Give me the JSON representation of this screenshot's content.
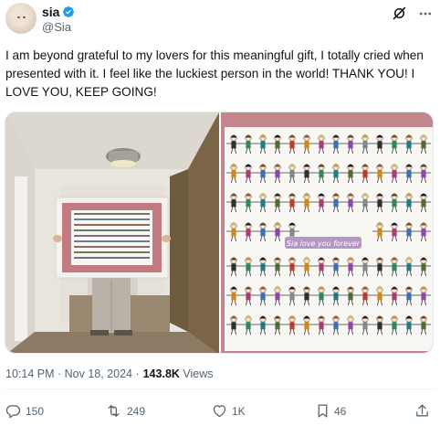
{
  "user": {
    "display_name": "sia",
    "handle": "@Sia",
    "verified": true
  },
  "tweet": {
    "text": "I am beyond grateful to my lovers for this meaningful gift, I totally cried when presented with it. I feel like the luckiest person in the world! THANK YOU! I LOVE YOU, KEEP GOING!",
    "timestamp": "10:14 PM · Nov 18, 2024 · ",
    "views_count": "143.8K",
    "views_label": " Views"
  },
  "media": {
    "image_1": "person-holding-framed-drawing-in-hallway",
    "image_2": "close-up-of-drawn-stick-figures-in-frame",
    "banner_text": "Sia love you forever"
  },
  "actions": {
    "replies": "150",
    "reposts": "249",
    "likes": "1K",
    "bookmarks": "46"
  },
  "icons": [
    "verified-badge-icon",
    "grok-icon",
    "more-icon",
    "reply-icon",
    "repost-icon",
    "like-icon",
    "bookmark-icon",
    "share-icon"
  ],
  "colors": {
    "verified": "#1d9bf0",
    "text_primary": "#0f1419",
    "text_secondary": "#536471"
  }
}
